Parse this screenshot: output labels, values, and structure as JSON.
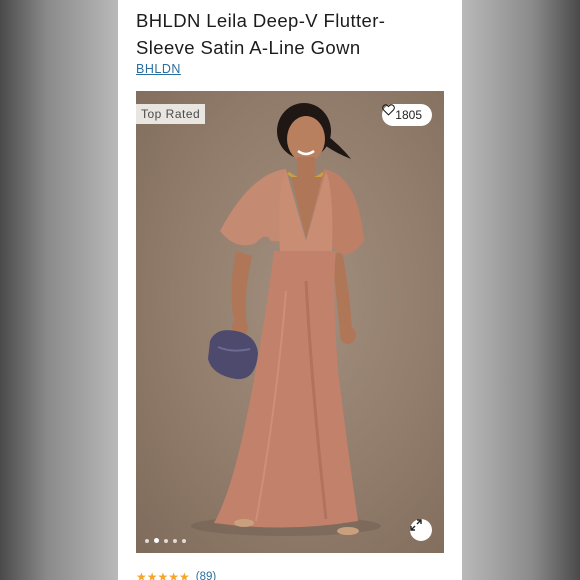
{
  "product": {
    "title": "BHLDN Leila Deep-V Flutter-Sleeve Satin A-Line Gown",
    "brand_link": "BHLDN"
  },
  "gallery": {
    "badge": "Top Rated",
    "likes_count": "1805",
    "current_image": 2,
    "image_count": 5,
    "expand_icon": "expand-arrows-icon",
    "like_icon": "heart-icon",
    "dress_color": "#c2816a",
    "background_color": "#917c6b"
  },
  "rating": {
    "stars": "★★★★★",
    "value": 4.5,
    "reviews": "(89)"
  },
  "colors": {
    "link": "#2b6fa0",
    "star": "#f4a52a"
  }
}
